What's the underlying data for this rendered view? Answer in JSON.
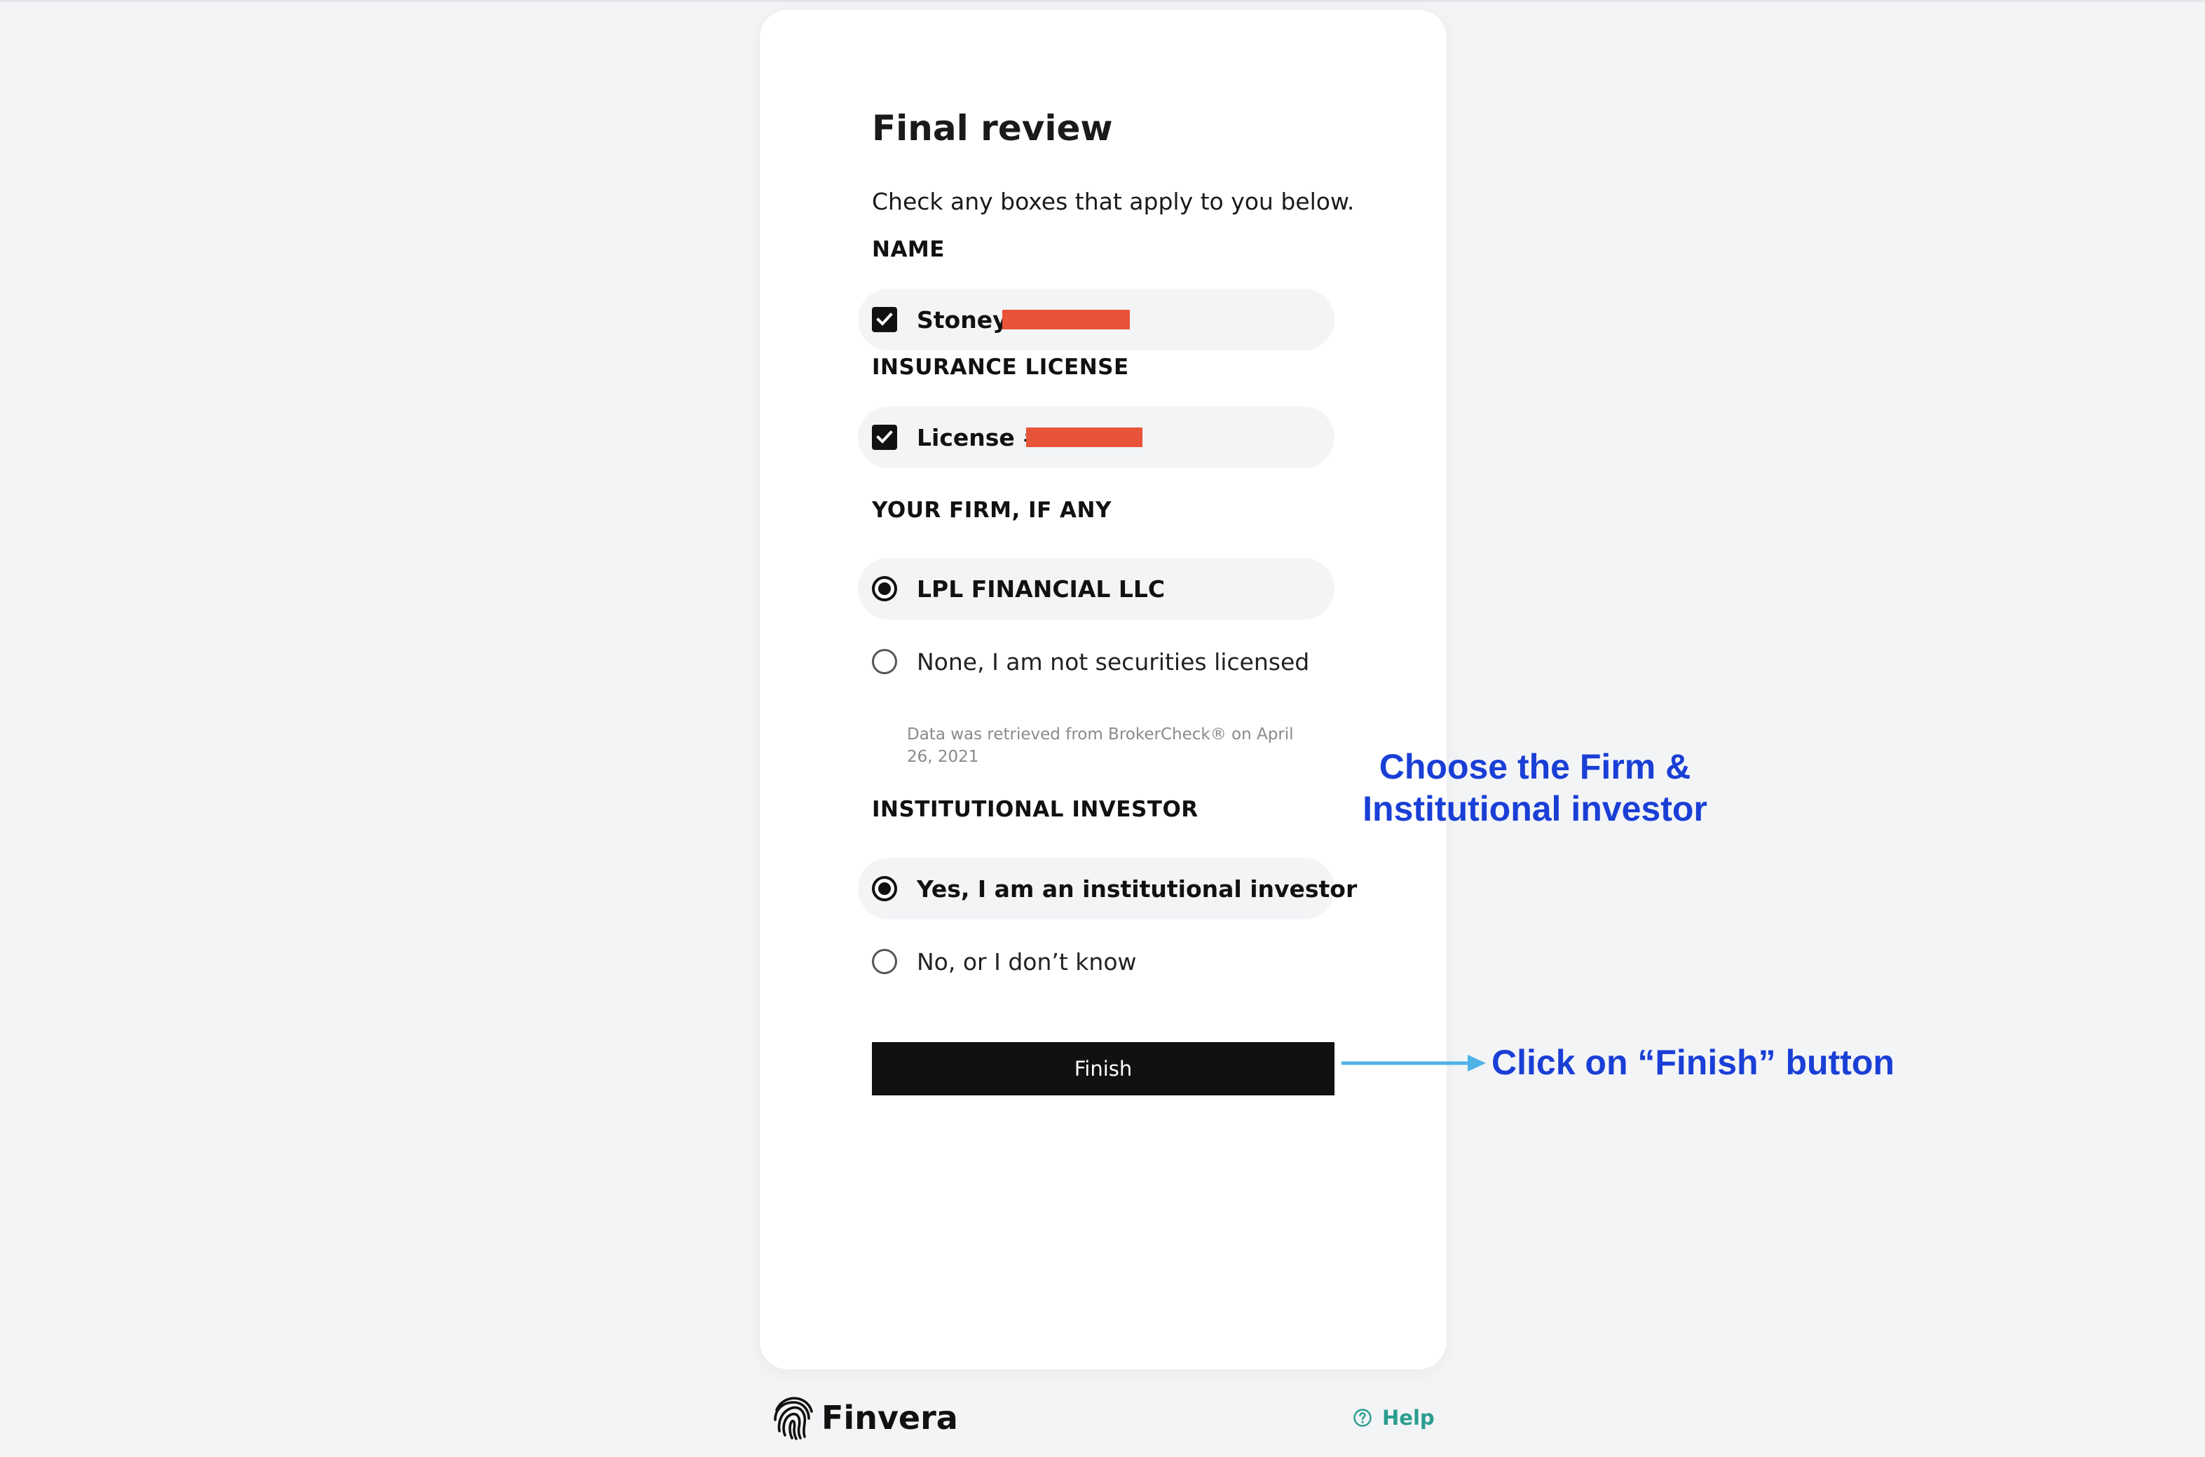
{
  "page": {
    "title": "Final review",
    "subtitle": "Check any boxes that apply to you below."
  },
  "name_section": {
    "label": "NAME",
    "option": {
      "text": "Stoney",
      "checked": true,
      "redacted": true
    }
  },
  "license_section": {
    "label": "INSURANCE LICENSE",
    "option": {
      "text": "License #",
      "checked": true,
      "redacted": true
    }
  },
  "firm_section": {
    "label": "YOUR FIRM, IF ANY",
    "options": [
      {
        "text": "LPL FINANCIAL LLC",
        "selected": true
      },
      {
        "text": "None, I am not securities licensed",
        "selected": false
      }
    ],
    "note": "Data was retrieved from BrokerCheck® on April 26, 2021"
  },
  "investor_section": {
    "label": "INSTITUTIONAL INVESTOR",
    "options": [
      {
        "text": "Yes, I am an institutional investor",
        "selected": true
      },
      {
        "text": "No, or I don’t know",
        "selected": false
      }
    ]
  },
  "actions": {
    "finish_label": "Finish"
  },
  "annotations": {
    "firm_hint": "Choose the Firm & Institutional investor",
    "finish_hint": "Click on “Finish” button"
  },
  "footer": {
    "brand": "Finvera",
    "help_label": "Help",
    "brand_icon": "fingerprint-icon",
    "help_icon": "question-circle-icon"
  },
  "colors": {
    "background": "#f3f4f6",
    "card": "#ffffff",
    "primary": "#111111",
    "annotation": "#1a3fd6",
    "arrow": "#4fb3e8",
    "help": "#2a9d8f",
    "redaction": "#e8543a"
  }
}
